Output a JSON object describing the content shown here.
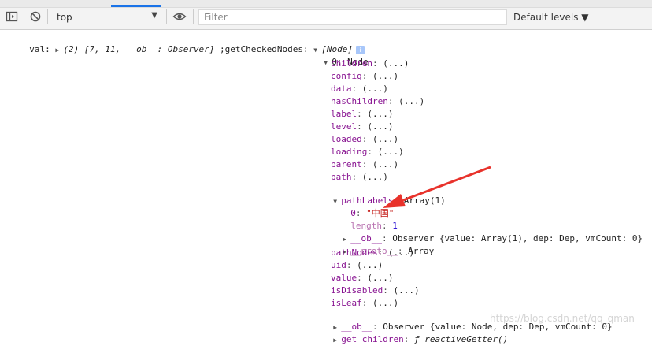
{
  "toolbar": {
    "context_value": "top",
    "filter_placeholder": "Filter",
    "levels_label": "Default levels ▼",
    "icons": [
      "sidebar-toggle-icon",
      "clear-console-icon",
      "eye-icon"
    ]
  },
  "console": {
    "line1": {
      "prefix": "val: ",
      "val_preview": "(2) [7, 11, __ob__: Observer]",
      "middle": " ;getCheckedNodes: ",
      "nodes_preview": "[Node]"
    },
    "node0_label": "0: Node",
    "props": [
      {
        "key": "children",
        "value": "(...)"
      },
      {
        "key": "config",
        "value": "(...)"
      },
      {
        "key": "data",
        "value": "(...)"
      },
      {
        "key": "hasChildren",
        "value": "(...)"
      },
      {
        "key": "label",
        "value": "(...)"
      },
      {
        "key": "level",
        "value": "(...)"
      },
      {
        "key": "loaded",
        "value": "(...)"
      },
      {
        "key": "loading",
        "value": "(...)"
      },
      {
        "key": "parent",
        "value": "(...)"
      },
      {
        "key": "path",
        "value": "(...)"
      }
    ],
    "pathLabels": {
      "key": "pathLabels",
      "value": "Array(1)",
      "item0_key": "0",
      "item0_value": "\"中国\"",
      "length_key": "length",
      "length_value": "1",
      "ob_key": "__ob__",
      "ob_value": "Observer {value: Array(1), dep: Dep, vmCount: 0}",
      "proto_key": "__proto__",
      "proto_value": "Array"
    },
    "props2": [
      {
        "key": "pathNodes",
        "value": "(...)"
      },
      {
        "key": "uid",
        "value": "(...)"
      },
      {
        "key": "value",
        "value": "(...)"
      },
      {
        "key": "isDisabled",
        "value": "(...)"
      },
      {
        "key": "isLeaf",
        "value": "(...)"
      }
    ],
    "node_ob": {
      "key": "__ob__",
      "value": "Observer {value: Node, dep: Dep, vmCount: 0}"
    },
    "getter": {
      "key": "get children",
      "value": "ƒ reactiveGetter()"
    }
  },
  "colors": {
    "annotation_arrow": "#e8322b",
    "key": "#881391",
    "string": "#c41a16",
    "number": "#1c00cf"
  },
  "watermark": "https://blog.csdn.net/qq_qman"
}
